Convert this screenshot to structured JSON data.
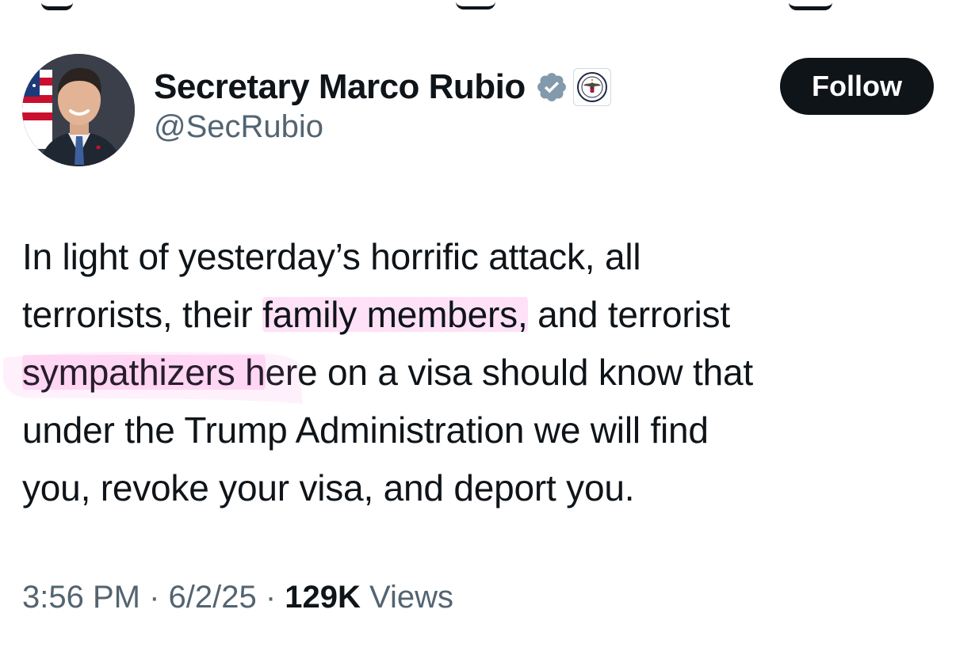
{
  "author": {
    "display_name": "Secretary Marco Rubio",
    "handle": "@SecRubio",
    "verified_icon": "verified-badge-icon",
    "affiliate_icon": "state-department-seal-icon"
  },
  "follow_label": "Follow",
  "tweet": {
    "lines": [
      {
        "before": "In light of yesterday’s horrific attack, all",
        "highlight": "",
        "after": ""
      },
      {
        "before": "terrorists, their ",
        "highlight": "family members,",
        "after": " and terrorist"
      },
      {
        "before": "",
        "highlight": "sympathizers h",
        "after": "ere on a visa should know that"
      },
      {
        "before": "under the Trump Administration we will find",
        "highlight": "",
        "after": ""
      },
      {
        "before": "you, revoke your visa, and deport you.",
        "highlight": "",
        "after": ""
      }
    ]
  },
  "meta": {
    "time": "3:56 PM",
    "separator1": " · ",
    "date": "6/2/25",
    "separator2": " · ",
    "views_count": "129K",
    "views_label": " Views"
  },
  "colors": {
    "text": "#0f1419",
    "secondary": "#536471",
    "highlight": "#ff78dc",
    "verified": "#829aab"
  }
}
